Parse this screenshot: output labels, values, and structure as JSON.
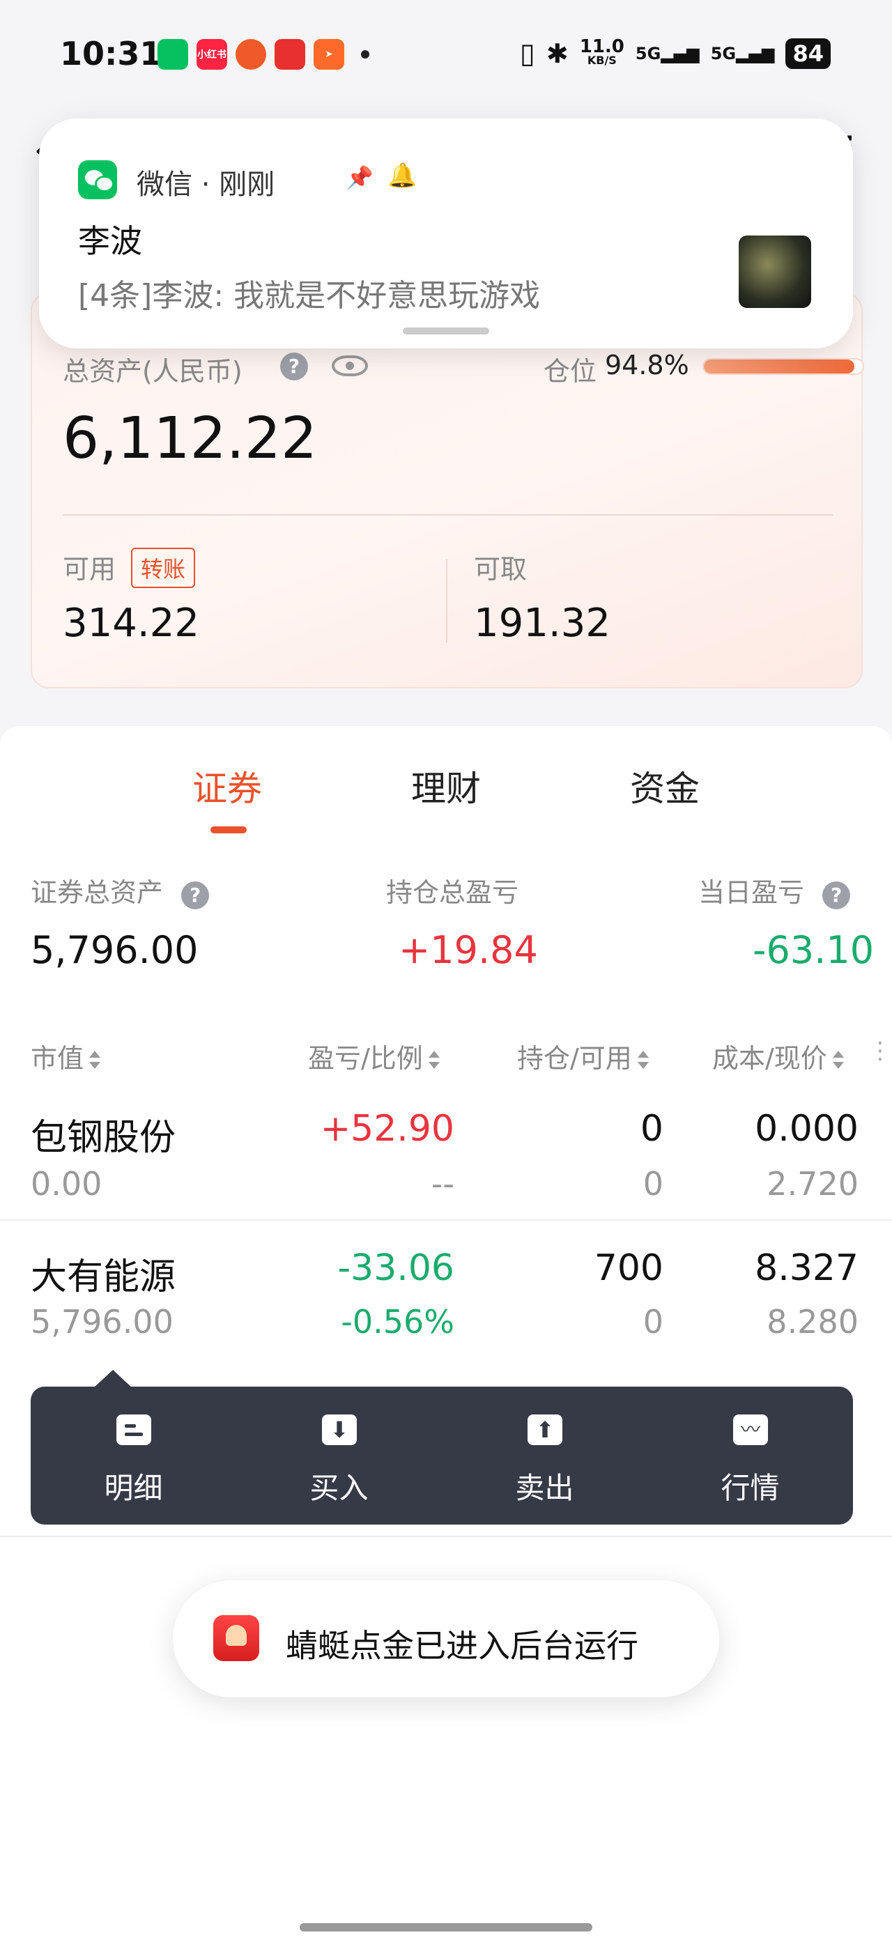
{
  "status_bar": {
    "time": "10:31",
    "net_speed": "11.0",
    "net_unit": "KB/S",
    "signal1": "5G",
    "signal2": "5G",
    "battery": "84",
    "app_icons": [
      {
        "name": "wechat-icon",
        "color": "#07c160",
        "text": ""
      },
      {
        "name": "xiaohongshu-icon",
        "color": "#ff2442",
        "text": "小红书"
      },
      {
        "name": "game-icon",
        "color": "#f05a28",
        "text": ""
      },
      {
        "name": "qingting-icon",
        "color": "#e8302e",
        "text": ""
      },
      {
        "name": "send-icon",
        "color": "#ff6a2a",
        "text": ""
      }
    ]
  },
  "notification": {
    "app": "微信 · 刚刚",
    "sender": "李波",
    "message": "[4条]李波: 我就是不好意思玩游戏"
  },
  "assets": {
    "total_label": "总资产(人民币)",
    "total_value": "6,112.22",
    "position_label": "仓位",
    "position_value": "94.8%",
    "position_fraction": 0.948,
    "available_label": "可用",
    "transfer_label": "转账",
    "available_value": "314.22",
    "withdrawable_label": "可取",
    "withdrawable_value": "191.32"
  },
  "tabs": [
    {
      "label": "证券",
      "active": true
    },
    {
      "label": "理财",
      "active": false
    },
    {
      "label": "资金",
      "active": false
    }
  ],
  "summary": {
    "securities_assets_label": "证券总资产",
    "securities_assets_value": "5,796.00",
    "holding_pl_label": "持仓总盈亏",
    "holding_pl_value": "+19.84",
    "daily_pl_label": "当日盈亏",
    "daily_pl_value": "-63.10"
  },
  "table": {
    "headers": [
      "市值",
      "盈亏/比例",
      "持仓/可用",
      "成本/现价"
    ],
    "rows": [
      {
        "name": "包钢股份",
        "market_value": "0.00",
        "pl": "+52.90",
        "pl_ratio": "--",
        "holding": "0",
        "available": "0",
        "cost": "0.000",
        "price": "2.720"
      },
      {
        "name": "大有能源",
        "market_value": "5,796.00",
        "pl": "-33.06",
        "pl_ratio": "-0.56%",
        "holding": "700",
        "available": "0",
        "cost": "8.327",
        "price": "8.280"
      }
    ]
  },
  "actions": [
    {
      "label": "明细"
    },
    {
      "label": "买入"
    },
    {
      "label": "卖出"
    },
    {
      "label": "行情"
    }
  ],
  "toast": {
    "text": "蜻蜓点金已进入后台运行"
  },
  "colors": {
    "accent": "#e9522c",
    "gain": "#e8343e",
    "loss": "#1aab6c",
    "popup_bg": "#363a46"
  }
}
